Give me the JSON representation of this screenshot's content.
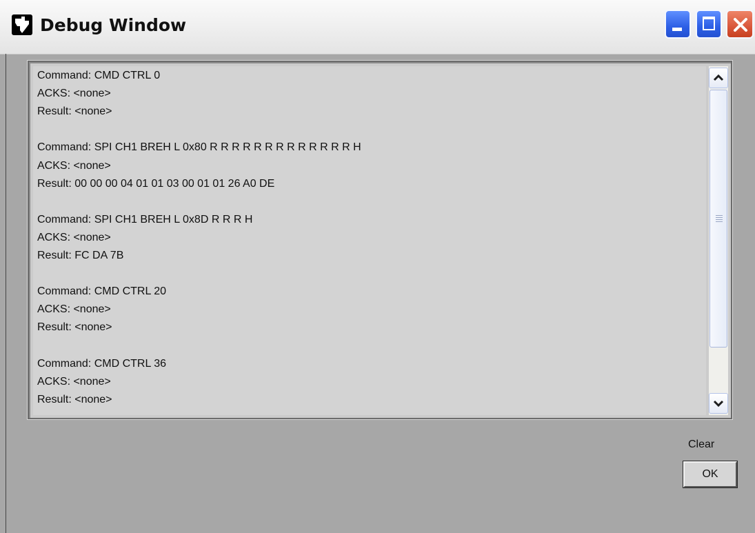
{
  "window": {
    "title": "Debug Window",
    "buttons": {
      "minimize": "minimize",
      "maximize": "maximize",
      "close": "close"
    }
  },
  "log": {
    "lines": [
      "Command: CMD CTRL 0",
      "ACKS: <none>",
      "Result: <none>",
      "",
      "Command: SPI CH1 BREH L 0x80 R R R R R R R R R R R R R H",
      "ACKS: <none>",
      "Result: 00 00 00 04 01 01 03 00 01 01 26 A0 DE",
      "",
      "Command: SPI CH1 BREH L 0x8D R R R H",
      "ACKS: <none>",
      "Result: FC DA 7B",
      "",
      "Command: CMD CTRL 20",
      "ACKS: <none>",
      "Result: <none>",
      "",
      "Command: CMD CTRL 36",
      "ACKS: <none>",
      "Result: <none>"
    ]
  },
  "controls": {
    "clear_label": "Clear",
    "ok_label": "OK"
  },
  "icons": {
    "app": "ti-logo-icon",
    "scroll_up": "chevron-up-icon",
    "scroll_down": "chevron-down-icon"
  },
  "colors": {
    "window_bg": "#a7a7a7",
    "log_bg": "#d3d3d3",
    "titlebar_button": "#2d5fe6",
    "close_button": "#d9573b"
  }
}
